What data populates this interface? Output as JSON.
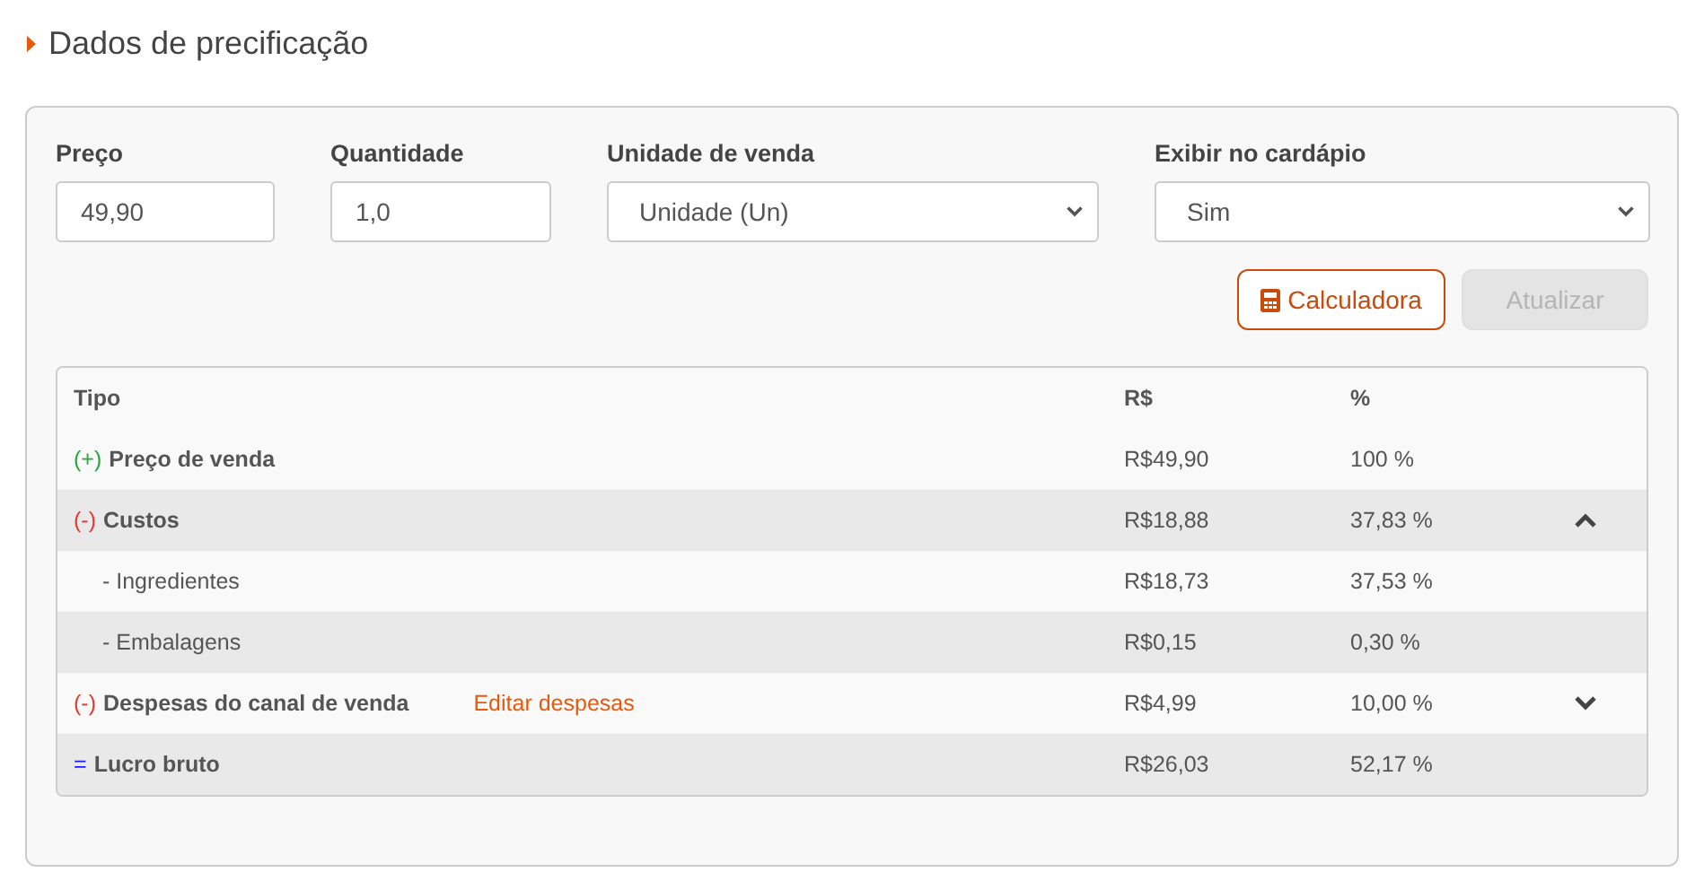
{
  "section_title": "Dados de precificação",
  "fields": [
    {
      "kind": "input",
      "label": "Preço",
      "value": "49,90"
    },
    {
      "kind": "input",
      "label": "Quantidade",
      "value": "1,0"
    },
    {
      "kind": "select",
      "label": "Unidade de venda",
      "value": "Unidade (Un)"
    },
    {
      "kind": "select",
      "label": "Exibir no cardápio",
      "value": "Sim"
    }
  ],
  "buttons": [
    {
      "label": "Calculadora",
      "disabled": false
    },
    {
      "label": "Atualizar",
      "disabled": true
    }
  ],
  "table": {
    "columns": [
      "Tipo",
      "R$",
      "%"
    ],
    "rows": [
      {
        "sign": "(+)",
        "color": "#28a745",
        "label": "Preço de venda",
        "value": "R$49,90",
        "percent": "100 %"
      },
      {
        "sign": "(-)",
        "color": "#e53935",
        "label": "Custos",
        "value": "R$18,88",
        "percent": "37,83 %",
        "expanded": true,
        "children": [
          {
            "label": "- Ingredientes",
            "value": "R$18,73",
            "percent": "37,53 %"
          },
          {
            "label": "- Embalagens",
            "value": "R$0,15",
            "percent": "0,30 %"
          }
        ]
      },
      {
        "sign": "(-)",
        "color": "#e53935",
        "label": "Despesas do canal de venda",
        "link": "Editar despesas",
        "value": "R$4,99",
        "percent": "10,00 %",
        "expanded": false
      },
      {
        "sign": "=",
        "color": "#1a1aff",
        "label": "Lucro bruto",
        "value": "R$26,03",
        "percent": "52,17 %"
      }
    ]
  }
}
